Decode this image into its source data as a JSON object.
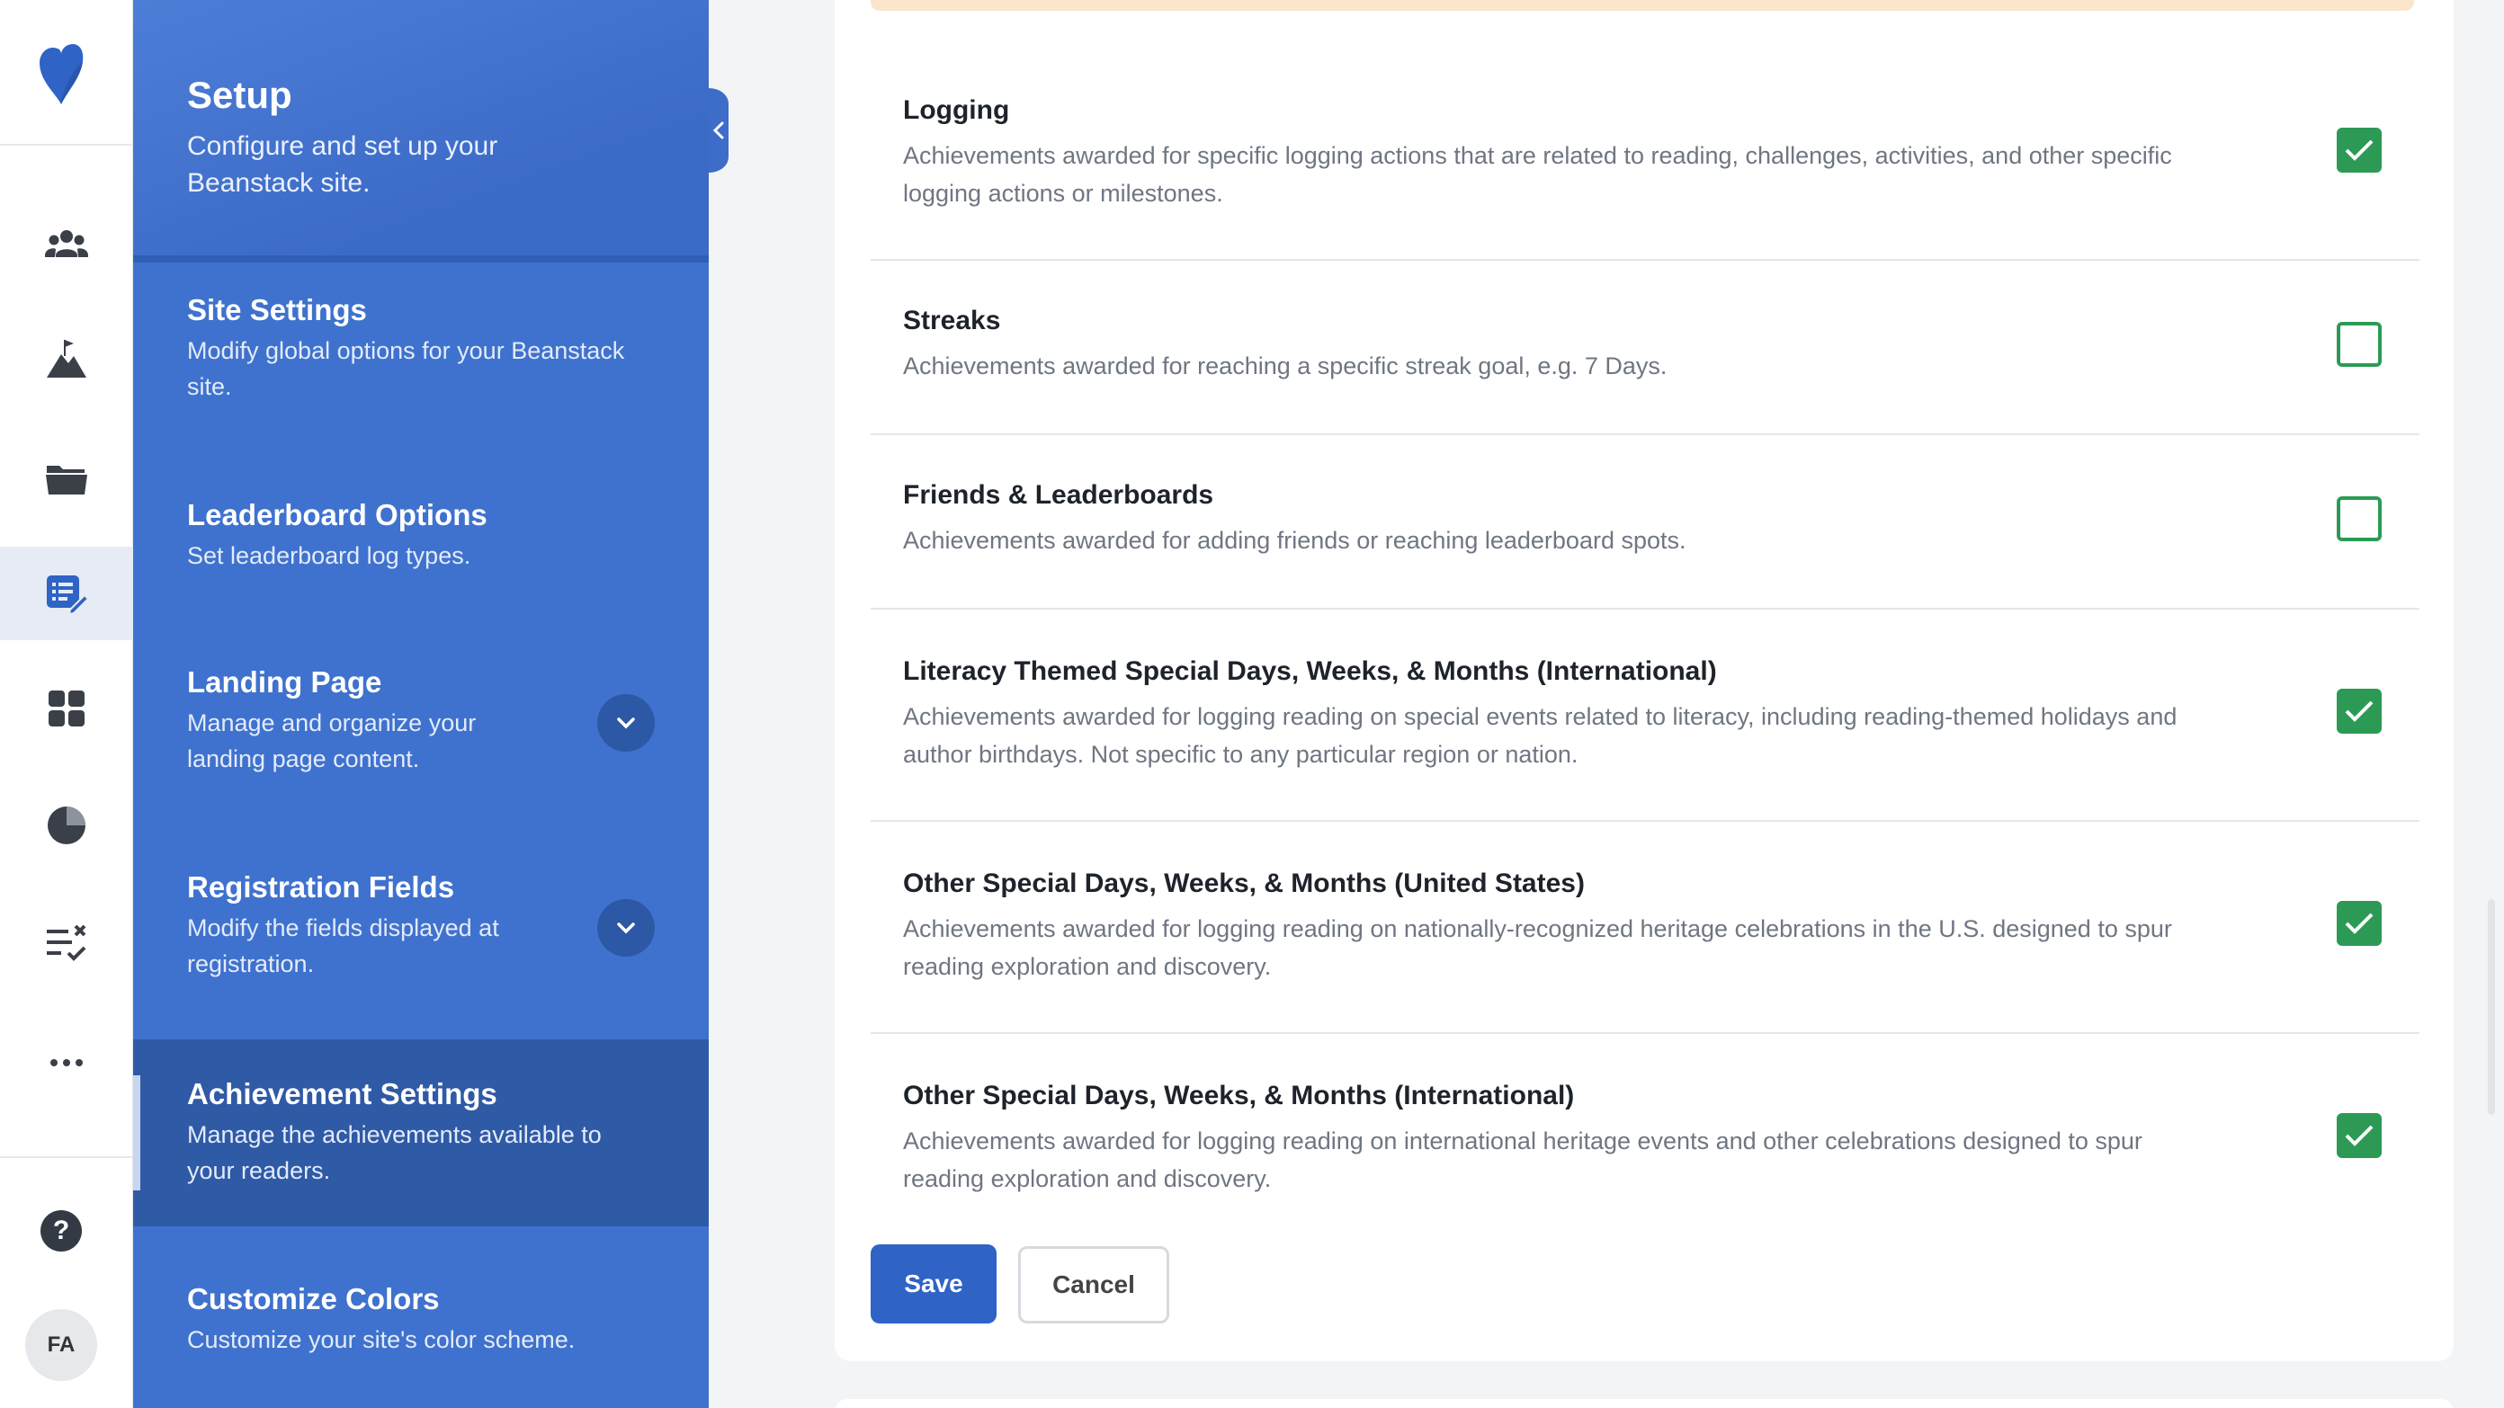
{
  "setup": {
    "title": "Setup",
    "subtitle": "Configure and set up your Beanstack site."
  },
  "rail": {
    "icons": [
      "heart-logo",
      "readers-icon",
      "challenges-icon",
      "folder-icon",
      "setup-icon",
      "widgets-icon",
      "reports-icon",
      "tasks-icon",
      "more-icon",
      "help-icon"
    ],
    "active_icon": "setup-icon",
    "help_label": "?",
    "avatar_initials": "FA"
  },
  "nav": {
    "items": [
      {
        "title": "Site Settings",
        "desc": "Modify global options for your Beanstack site."
      },
      {
        "title": "Leaderboard Options",
        "desc": "Set leaderboard log types."
      },
      {
        "title": "Landing Page",
        "desc": "Manage and organize your landing page content."
      },
      {
        "title": "Registration Fields",
        "desc": "Modify the fields displayed at registration."
      },
      {
        "title": "Achievement Settings",
        "desc": "Manage the achievements available to your readers."
      },
      {
        "title": "Customize Colors",
        "desc": "Customize your site's color scheme."
      }
    ],
    "active": "Achievement Settings"
  },
  "achievements": [
    {
      "title": "Logging",
      "desc": "Achievements awarded for specific logging actions that are related to reading, challenges, activities, and other specific logging actions or milestones.",
      "checked": true
    },
    {
      "title": "Streaks",
      "desc": "Achievements awarded for reaching a specific streak goal, e.g. 7 Days.",
      "checked": false
    },
    {
      "title": "Friends & Leaderboards",
      "desc": "Achievements awarded for adding friends or reaching leaderboard spots.",
      "checked": false
    },
    {
      "title": "Literacy Themed Special Days, Weeks, & Months (International)",
      "desc": "Achievements awarded for logging reading on special events related to literacy, including reading-themed holidays and author birthdays. Not specific to any particular region or nation.",
      "checked": true
    },
    {
      "title": "Other Special Days, Weeks, & Months (United States)",
      "desc": "Achievements awarded for logging reading on nationally-recognized heritage celebrations in the U.S. designed to spur reading exploration and discovery.",
      "checked": true
    },
    {
      "title": "Other Special Days, Weeks, & Months (International)",
      "desc": "Achievements awarded for logging reading on international heritage events and other celebrations designed to spur reading exploration and discovery.",
      "checked": true
    }
  ],
  "actions": {
    "save_label": "Save",
    "cancel_label": "Cancel"
  },
  "colors": {
    "brand_blue": "#3f72ce",
    "active_nav": "#2f5aa6",
    "check_green": "#2c9a55",
    "save_button": "#2f63c6"
  }
}
